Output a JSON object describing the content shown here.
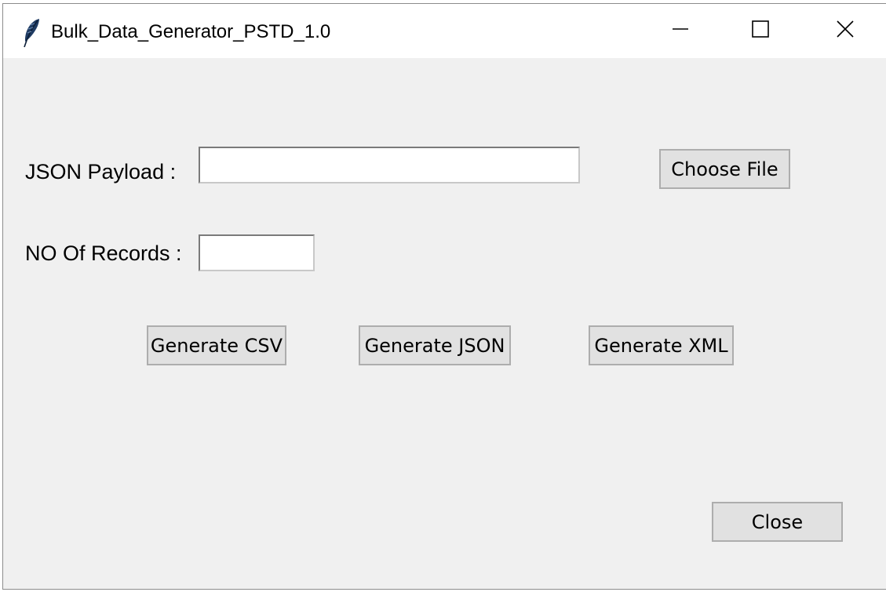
{
  "window": {
    "title": "Bulk_Data_Generator_PSTD_1.0",
    "icon": "feather-icon",
    "controls": {
      "minimize": "minimize-icon",
      "maximize": "maximize-icon",
      "close": "close-icon"
    }
  },
  "form": {
    "json_payload": {
      "label": "JSON Payload :",
      "value": ""
    },
    "choose_file_label": "Choose File",
    "records": {
      "label": "NO Of Records :",
      "value": ""
    }
  },
  "actions": {
    "generate_csv": "Generate CSV",
    "generate_json": "Generate JSON",
    "generate_xml": "Generate XML",
    "close": "Close"
  },
  "colors": {
    "background": "#f0f0f0",
    "button_face": "#e1e1e1",
    "button_border": "#adadad",
    "titlebar": "#ffffff"
  }
}
